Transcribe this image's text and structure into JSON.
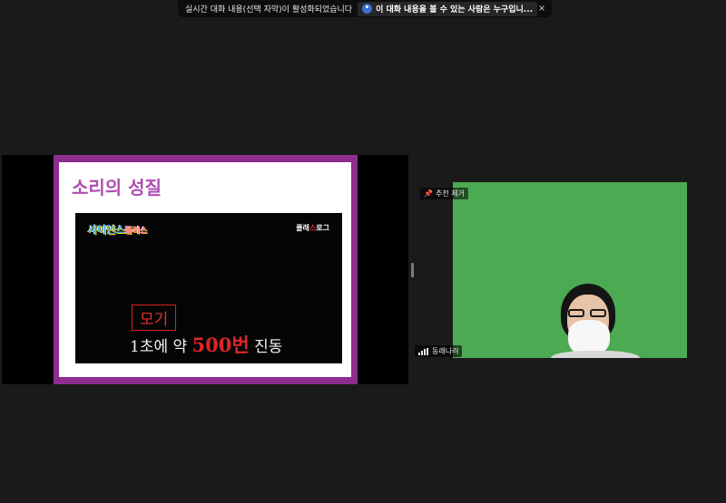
{
  "notice": {
    "text": "실시간 대화 내용(선택 자막)이 활성화되었습니다",
    "chip_label": "이 대화 내용을 볼 수 있는 사람은 누구입니...",
    "chip_icon": "people-info-icon",
    "close_label": "×"
  },
  "share": {
    "slide_title": "소리의 성질",
    "video": {
      "logo": "사이언스",
      "logo_plus": "플러스",
      "brand_prefix": "클래",
      "brand_red": "스",
      "brand_suffix": "로그",
      "word": "모기",
      "caption_prefix": "1초에 약 ",
      "caption_number": "500번",
      "caption_suffix": " 진동"
    }
  },
  "participant": {
    "unpin_label": "추천 제거",
    "pin_icon": "pin-icon",
    "name": "동래나려",
    "signal_icon": "signal-bars-icon"
  },
  "colors": {
    "background": "#1a1a1a",
    "slide_border": "#8e2d8f",
    "slide_title": "#b04db3",
    "video_bg": "#4caa52"
  }
}
